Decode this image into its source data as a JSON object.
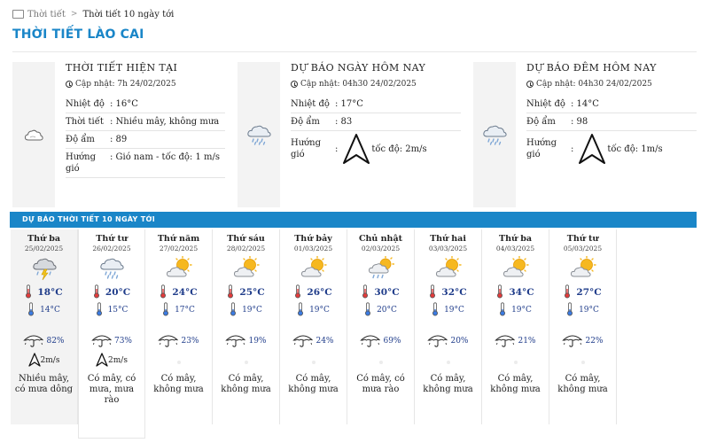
{
  "breadcrumb": {
    "home": "Thời tiết",
    "separator": ">",
    "current": "Thời tiết 10 ngày tới"
  },
  "page_title": "THỜI TIẾT LÀO CAI",
  "panels": [
    {
      "title": "THỜI TIẾT HIỆN TẠI",
      "updated": "Cập nhật: 7h 24/02/2025",
      "icon": "cloud-icon",
      "rows": [
        {
          "label": "Nhiệt độ",
          "value": ": 16°C"
        },
        {
          "label": "Thời tiết",
          "value": ": Nhiều mây, không mưa"
        },
        {
          "label": "Độ ẩm",
          "value": ": 89"
        },
        {
          "label": "Hướng gió",
          "value": ": Gió nam - tốc độ: 1 m/s"
        }
      ]
    },
    {
      "title": "DỰ BÁO NGÀY HÔM NAY",
      "updated": "Cập nhật: 04h30 24/02/2025",
      "icon": "rain-cloud-icon",
      "rows": [
        {
          "label": "Nhiệt độ",
          "value": ": 17°C"
        },
        {
          "label": "Độ ẩm",
          "value": ": 83"
        },
        {
          "label": "Hướng gió",
          "colon": ":",
          "value": "tốc độ: 2m/s"
        }
      ]
    },
    {
      "title": "DỰ BÁO ĐÊM HÔM NAY",
      "updated": "Cập nhật: 04h30 24/02/2025",
      "icon": "rain-cloud-icon",
      "rows": [
        {
          "label": "Nhiệt độ",
          "value": ": 14°C"
        },
        {
          "label": "Độ ẩm",
          "value": ": 98"
        },
        {
          "label": "Hướng gió",
          "colon": ":",
          "value": "tốc độ: 1m/s"
        }
      ]
    }
  ],
  "forecast_header": "DỰ BÁO THỜI TIẾT 10 NGÀY TỚI",
  "days": [
    {
      "name": "Thứ ba",
      "date": "25/02/2025",
      "icon": "storm-cloud-icon",
      "max": "18°C",
      "min": "14°C",
      "rain": "82%",
      "wind": "2m/s",
      "desc": "Nhiều mây, có mưa dông"
    },
    {
      "name": "Thứ tư",
      "date": "26/02/2025",
      "icon": "rain-cloud-icon",
      "max": "20°C",
      "min": "15°C",
      "rain": "73%",
      "wind": "2m/s",
      "desc": "Có mây, có mưa, mưa rào"
    },
    {
      "name": "Thứ năm",
      "date": "27/02/2025",
      "icon": "sun-cloud-icon",
      "max": "24°C",
      "min": "17°C",
      "rain": "23%",
      "desc": "Có mây, không mưa"
    },
    {
      "name": "Thứ sáu",
      "date": "28/02/2025",
      "icon": "sun-cloud-icon",
      "max": "25°C",
      "min": "19°C",
      "rain": "19%",
      "desc": "Có mây, không mưa"
    },
    {
      "name": "Thứ bảy",
      "date": "01/03/2025",
      "icon": "sun-cloud-icon",
      "max": "26°C",
      "min": "19°C",
      "rain": "24%",
      "desc": "Có mây, không mưa"
    },
    {
      "name": "Chủ nhật",
      "date": "02/03/2025",
      "icon": "sun-rain-icon",
      "max": "30°C",
      "min": "20°C",
      "rain": "69%",
      "desc": "Có mây, có mưa rào"
    },
    {
      "name": "Thứ hai",
      "date": "03/03/2025",
      "icon": "sun-cloud-icon",
      "max": "32°C",
      "min": "19°C",
      "rain": "20%",
      "desc": "Có mây, không mưa"
    },
    {
      "name": "Thứ ba",
      "date": "04/03/2025",
      "icon": "sun-cloud-icon",
      "max": "34°C",
      "min": "19°C",
      "rain": "21%",
      "desc": "Có mây, không mưa"
    },
    {
      "name": "Thứ tư",
      "date": "05/03/2025",
      "icon": "sun-cloud-icon",
      "max": "27°C",
      "min": "19°C",
      "rain": "22%",
      "desc": "Có mây, không mưa"
    }
  ],
  "colors": {
    "accent": "#1a86c8",
    "temp": "#1f3c8a"
  }
}
